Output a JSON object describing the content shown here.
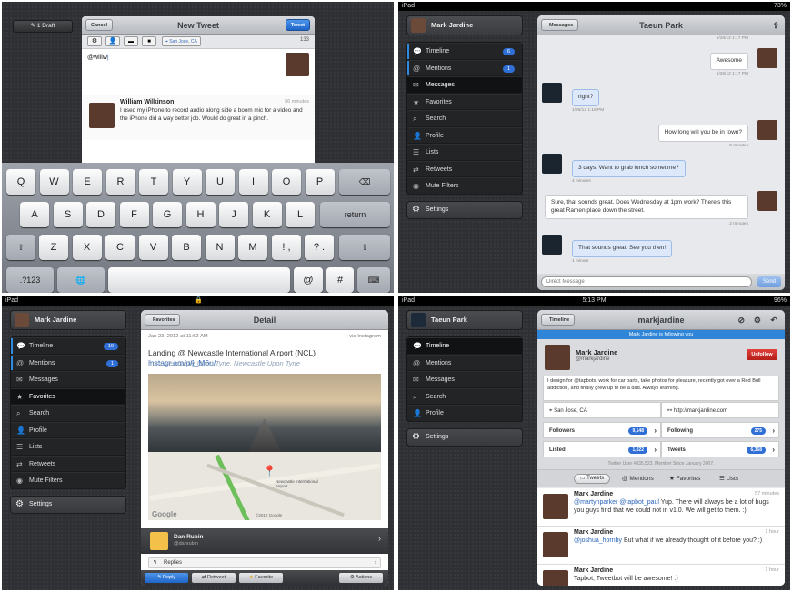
{
  "q1": {
    "drafts": "1 Draft",
    "title": "New Tweet",
    "cancel": "Cancel",
    "tweet": "Tweet",
    "location": "San Jose, CA",
    "count": "133",
    "text": "@willw",
    "suggest_name": "William Wilkinson",
    "suggest_time": "56 minutes",
    "suggest_text": "I used my iPhone to record audio along side a boom mic for a video and the iPhone did a way better job. Would do great in a pinch.",
    "keys_row1": [
      "Q",
      "W",
      "E",
      "R",
      "T",
      "Y",
      "U",
      "I",
      "O",
      "P"
    ],
    "keys_row2": [
      "A",
      "S",
      "D",
      "F",
      "G",
      "H",
      "J",
      "K",
      "L"
    ],
    "keys_row3": [
      "Z",
      "X",
      "C",
      "V",
      "B",
      "N",
      "M",
      "!",
      ",",
      "?",
      "."
    ],
    "return": "return",
    "num": ".?123",
    "icons": [
      "backspace-icon",
      "shift-icon",
      "globe-icon",
      "keyboard-hide-icon",
      "gear-icon",
      "person-icon",
      "camera-icon",
      "location-pin-icon"
    ]
  },
  "q2": {
    "status_left": "iPad",
    "status_right": "73%",
    "user": "Mark Jardine",
    "sidebar": [
      {
        "label": "Timeline",
        "badge": "6"
      },
      {
        "label": "Mentions",
        "badge": "1"
      },
      {
        "label": "Messages",
        "badge": ""
      },
      {
        "label": "Favorites",
        "badge": ""
      },
      {
        "label": "Search",
        "badge": ""
      },
      {
        "label": "Profile",
        "badge": ""
      },
      {
        "label": "Lists",
        "badge": ""
      },
      {
        "label": "Retweets",
        "badge": ""
      },
      {
        "label": "Mute Filters",
        "badge": ""
      }
    ],
    "settings": "Settings",
    "back": "Messages",
    "title": "Taeun Park",
    "messages": [
      {
        "who": "me",
        "text": "Awesome",
        "time": "1/26/12 1:17 PM"
      },
      {
        "who": "them",
        "text": "right?",
        "time": "1/26/12 1:18 PM"
      },
      {
        "who": "me",
        "text": "How long will you be in town?",
        "time": "5 minutes"
      },
      {
        "who": "them",
        "text": "3 days. Want to grab lunch sometime?",
        "time": "4 minutes"
      },
      {
        "who": "me",
        "text": "Sure, that sounds great. Does Wednesday at 1pm work? There's this great Ramen place down the street.",
        "time": "2 minutes"
      },
      {
        "who": "them",
        "text": "That sounds great. See you then!",
        "time": "1 minute"
      }
    ],
    "top_time": "1/26/12 1:17 PM",
    "placeholder": "Direct Message",
    "send": "Send"
  },
  "q3": {
    "status_left": "iPad",
    "status_right": "",
    "user": "Mark Jardine",
    "sidebar": [
      {
        "label": "Timeline",
        "badge": "10"
      },
      {
        "label": "Mentions",
        "badge": "1"
      },
      {
        "label": "Messages",
        "badge": ""
      },
      {
        "label": "Favorites",
        "badge": ""
      },
      {
        "label": "Search",
        "badge": ""
      },
      {
        "label": "Profile",
        "badge": ""
      },
      {
        "label": "Lists",
        "badge": ""
      },
      {
        "label": "Retweets",
        "badge": ""
      },
      {
        "label": "Mute Filters",
        "badge": ""
      }
    ],
    "settings": "Settings",
    "back": "Favorites",
    "title": "Detail",
    "date": "Jan 23, 2012 at 11:52 AM",
    "via": "via Instagram",
    "tweet_text": "Landing  @ Newcastle International Airport (NCL)",
    "tweet_link": "instagr.am/p/j_M6u/",
    "from": "from Newcastle Upon Tyne, Newcastle Upon Tyne",
    "map_label": "Newcastle International Airport",
    "map_credit": "Google",
    "map_copy": "©2012 Google",
    "author": "Dan Rubin",
    "author_handle": "@danrubin",
    "replies": "Replies",
    "reply": "Reply",
    "retweet": "Retweet",
    "favorite": "Favorite",
    "actions": "Actions"
  },
  "q4": {
    "status_left": "iPad",
    "status_center": "5:13 PM",
    "status_right": "96%",
    "user": "Taeun Park",
    "sidebar": [
      {
        "label": "Timeline",
        "badge": ""
      },
      {
        "label": "Mentions",
        "badge": ""
      },
      {
        "label": "Messages",
        "badge": ""
      },
      {
        "label": "Search",
        "badge": ""
      },
      {
        "label": "Profile",
        "badge": ""
      }
    ],
    "settings": "Settings",
    "back": "Timeline",
    "title": "markjardine",
    "following_banner": "Mark Jardine is following you",
    "name": "Mark Jardine",
    "handle": "@markjardine",
    "unfollow": "Unfollow",
    "bio": "I design for @tapbots, work for car parts, take photos for pleasure, recently got over a Red Bull addiction, and finally grew up to be a dad. Always learning.",
    "location": "San Jose, CA",
    "url": "http://markjardine.com",
    "followers_label": "Followers",
    "followers": "9,148",
    "following_label": "Following",
    "following": "275",
    "listed_label": "Listed",
    "listed": "1,022",
    "tweets_label": "Tweets",
    "tweets": "6,368",
    "member_since": "Twitter User #835,523. Member Since January 2007.",
    "tabs": [
      "Tweets",
      "Mentions",
      "Favorites",
      "Lists"
    ],
    "timeline": [
      {
        "name": "Mark Jardine",
        "time": "57 minutes",
        "mention": "@martynparker @tapbot_paul",
        "text": " Yup. There will always be a lot of bugs you guys find that we could not in v1.0. We will get to them. :)"
      },
      {
        "name": "Mark Jardine",
        "time": "1 hour",
        "mention": "@joshua_hornby",
        "text": " But what if we already thought of it before you? :)"
      },
      {
        "name": "Mark Jardine",
        "time": "1 hour",
        "mention": "",
        "text": "Tapbot, Tweetbot will be awesome! :)"
      }
    ]
  }
}
